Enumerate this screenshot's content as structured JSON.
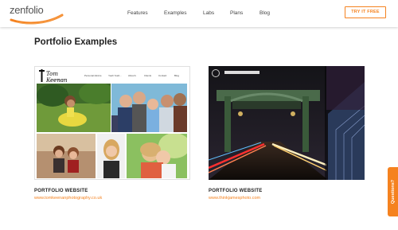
{
  "brand": {
    "logo_text": "zenfolio",
    "accent_color": "#f5821f"
  },
  "nav": {
    "items": [
      "Features",
      "Examples",
      "Labs",
      "Plans",
      "Blog"
    ],
    "cta_label": "TRY IT FREE"
  },
  "main": {
    "title": "Portfolio Examples",
    "cards": [
      {
        "label": "PORTFOLIO WEBSITE",
        "link": "www.tomkeenanphotography.co.uk",
        "thumb": {
          "brand_name": "Tom Keenan",
          "brand_sub": "photography",
          "nav": [
            "Personal Advice",
            "Yeah Yeah...",
            "About's",
            "Clients",
            "Contact",
            "Blog"
          ]
        }
      },
      {
        "label": "PORTFOLIO WEBSITE",
        "link": "www.thinkjamesphoto.com"
      }
    ]
  },
  "help_tab": {
    "label": "Questions?"
  }
}
